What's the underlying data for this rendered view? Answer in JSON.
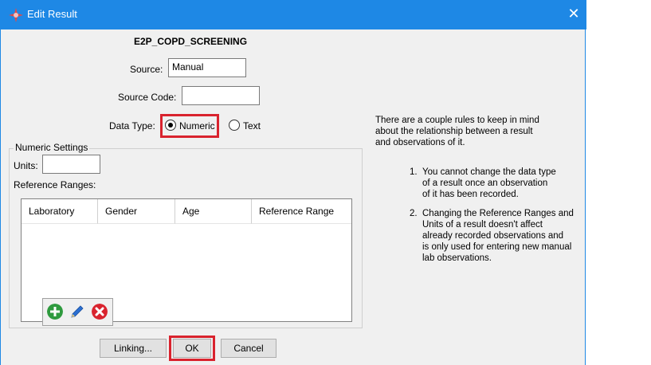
{
  "window": {
    "title": "Edit Result",
    "close_glyph": "✕"
  },
  "heading": "E2P_COPD_SCREENING",
  "source": {
    "label": "Source:",
    "value": "Manual"
  },
  "source_code": {
    "label": "Source Code:",
    "value": ""
  },
  "data_type": {
    "label": "Data Type:",
    "options": [
      "Numeric",
      "Text"
    ],
    "selected": "Numeric"
  },
  "numeric_settings": {
    "group_label": "Numeric Settings",
    "units_label": "Units:",
    "units_value": "",
    "reference_ranges_label": "Reference Ranges:",
    "columns": [
      "Laboratory",
      "Gender",
      "Age",
      "Reference Range"
    ],
    "rows": []
  },
  "toolbar": {
    "icons": [
      "add-icon",
      "edit-icon",
      "delete-icon"
    ]
  },
  "buttons": {
    "linking": "Linking...",
    "ok": "OK",
    "cancel": "Cancel"
  },
  "help": {
    "intro_1": "There are a couple rules to keep in mind",
    "intro_2": "about the relationship between a result",
    "intro_3": "and observations of it.",
    "rule1_num": "1.",
    "rule1_l1": "You cannot change the data type",
    "rule1_l2": "of a result once an observation",
    "rule1_l3": "of it has been recorded.",
    "rule2_num": "2.",
    "rule2_l1": "Changing the Reference Ranges and",
    "rule2_l2": "Units of a result doesn't affect",
    "rule2_l3": "already recorded observations and",
    "rule2_l4": "is only used for entering new manual",
    "rule2_l5": "lab observations."
  },
  "colors": {
    "titlebar": "#1e88e5",
    "highlight": "#d9232e",
    "add": "#2e9a3e",
    "edit": "#2b6fd1",
    "delete": "#d9232e"
  }
}
